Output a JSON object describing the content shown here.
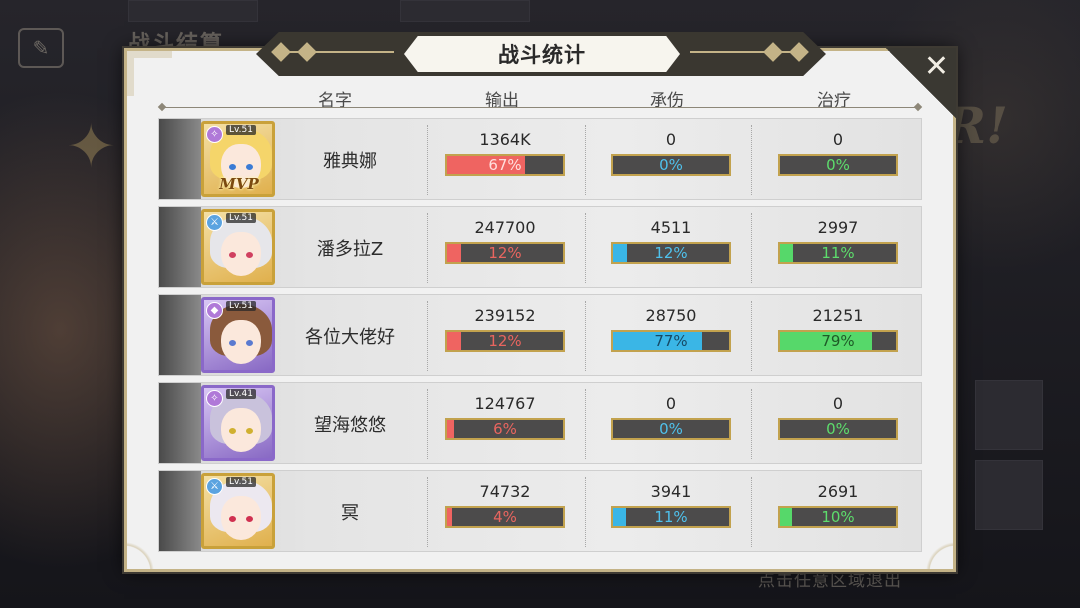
{
  "background": {
    "title": "战斗结算",
    "hint": "点击任意区域退出",
    "logo_text": "R!"
  },
  "dialog": {
    "title": "战斗统计",
    "close_label": "✕",
    "headers": {
      "name": "名字",
      "damage": "输出",
      "tank": "承伤",
      "heal": "治疗"
    }
  },
  "colors": {
    "frame_gold": "#c4b387",
    "damage_bar": "#ef6461",
    "tank_bar": "#3ab6e6",
    "heal_bar": "#56d86a",
    "bar_background": "#4c4b4b"
  },
  "players": [
    {
      "name": "雅典娜",
      "level": "Lv.51",
      "class_icon": "mage-icon",
      "mvp": "MVP",
      "damage": {
        "value": "1364K",
        "percent": "67%",
        "ratio": 0.67
      },
      "tank": {
        "value": "0",
        "percent": "0%",
        "ratio": 0
      },
      "heal": {
        "value": "0",
        "percent": "0%",
        "ratio": 0
      }
    },
    {
      "name": "潘多拉Z",
      "level": "Lv.51",
      "class_icon": "sword-icon",
      "damage": {
        "value": "247700",
        "percent": "12%",
        "ratio": 0.12
      },
      "tank": {
        "value": "4511",
        "percent": "12%",
        "ratio": 0.12
      },
      "heal": {
        "value": "2997",
        "percent": "11%",
        "ratio": 0.11
      }
    },
    {
      "name": "各位大佬好",
      "level": "Lv.51",
      "class_icon": "shield-icon",
      "damage": {
        "value": "239152",
        "percent": "12%",
        "ratio": 0.12
      },
      "tank": {
        "value": "28750",
        "percent": "77%",
        "ratio": 0.77
      },
      "heal": {
        "value": "21251",
        "percent": "79%",
        "ratio": 0.79
      }
    },
    {
      "name": "望海悠悠",
      "level": "Lv.41",
      "class_icon": "mage-icon",
      "damage": {
        "value": "124767",
        "percent": "6%",
        "ratio": 0.06
      },
      "tank": {
        "value": "0",
        "percent": "0%",
        "ratio": 0
      },
      "heal": {
        "value": "0",
        "percent": "0%",
        "ratio": 0
      }
    },
    {
      "name": "冥",
      "level": "Lv.51",
      "class_icon": "sword-icon",
      "damage": {
        "value": "74732",
        "percent": "4%",
        "ratio": 0.04
      },
      "tank": {
        "value": "3941",
        "percent": "11%",
        "ratio": 0.11
      },
      "heal": {
        "value": "2691",
        "percent": "10%",
        "ratio": 0.1
      }
    }
  ]
}
